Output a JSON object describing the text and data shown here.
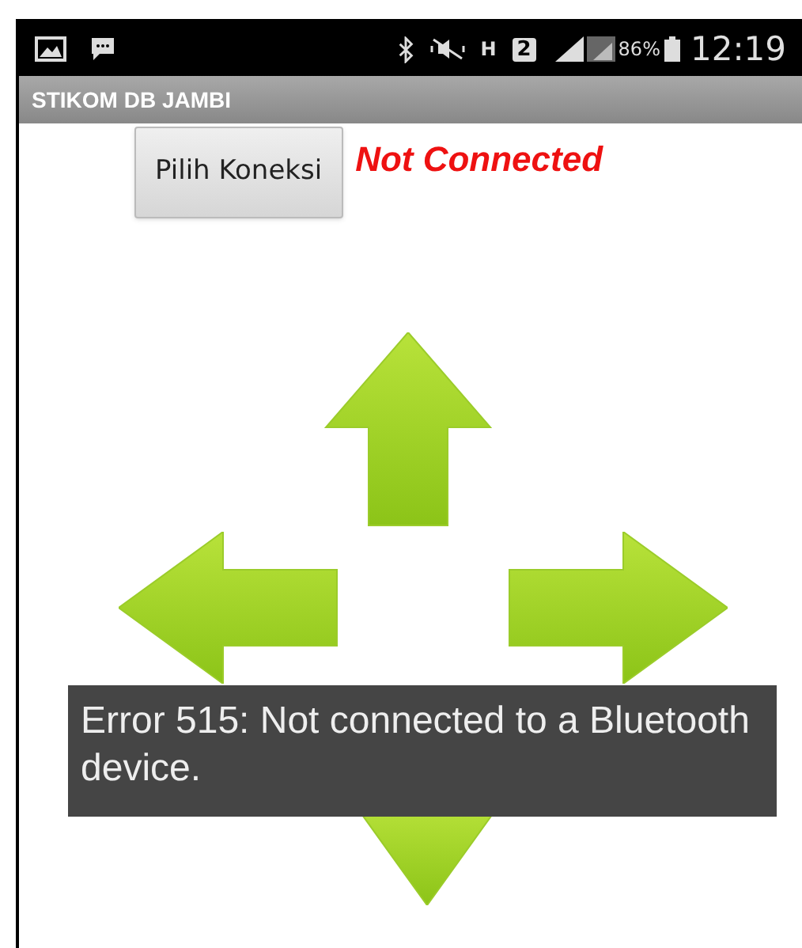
{
  "status_bar": {
    "network": "H",
    "sim": "2",
    "battery": "86%",
    "time": "12:19"
  },
  "title_bar": {
    "title": "STIKOM DB JAMBI"
  },
  "connect_button": {
    "label": "Pilih Koneksi"
  },
  "connection_status": {
    "text": "Not Connected",
    "connected": false
  },
  "arrows": [
    {
      "kind": "up"
    },
    {
      "kind": "left"
    },
    {
      "kind": "right"
    },
    {
      "kind": "down"
    }
  ],
  "toast": {
    "text": "Error 515: Not connected to a Bluetooth device."
  }
}
